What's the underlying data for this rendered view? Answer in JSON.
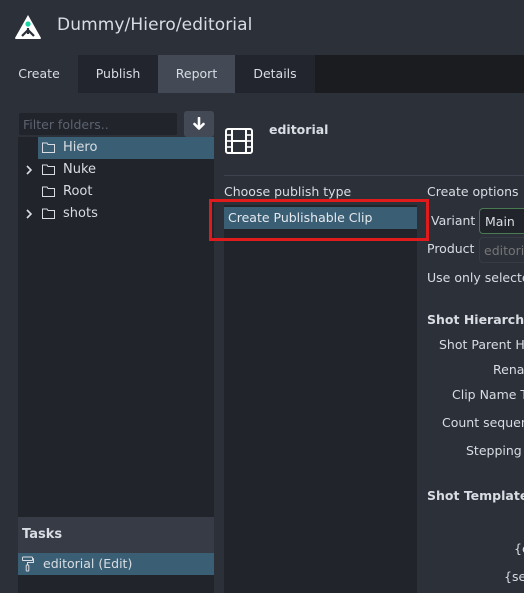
{
  "window": {
    "title": "Dummy/Hiero/editorial",
    "logo_icon": "ayon-logo-icon"
  },
  "tabs": [
    {
      "label": "Create",
      "active": false
    },
    {
      "label": "Publish",
      "active": false
    },
    {
      "label": "Report",
      "active": true
    },
    {
      "label": "Details",
      "active": false
    }
  ],
  "folders": {
    "filter_placeholder": "Filter folders..",
    "filter_value": "",
    "action_icon": "arrow-down-icon",
    "items": [
      {
        "label": "Hiero",
        "expandable": false,
        "selected": true
      },
      {
        "label": "Nuke",
        "expandable": true,
        "selected": false
      },
      {
        "label": "Root",
        "expandable": false,
        "selected": false
      },
      {
        "label": "shots",
        "expandable": true,
        "selected": false
      }
    ]
  },
  "tasks": {
    "header": "Tasks",
    "items": [
      {
        "label": "editorial (Edit)",
        "icon": "paint-roller-icon",
        "selected": true
      }
    ]
  },
  "context": {
    "icon": "film-icon",
    "title": "editorial"
  },
  "publish_types": {
    "label": "Choose publish type",
    "items": [
      {
        "label": "Create Publishable Clip",
        "selected": true
      }
    ]
  },
  "create_options": {
    "header": "Create options",
    "variant_label": "Variant",
    "variant_value": "Main",
    "product_label": "Product",
    "product_placeholder": "editorial",
    "use_only_selected": "Use only selected",
    "shot_hierarchy_header": "Shot Hierarchy",
    "shot_hierarchy_fields": [
      "Shot Parent Hierarchy",
      "Rename",
      "Clip Name Template",
      "Count sequence",
      "Stepping"
    ],
    "shot_template_header": "Shot Template",
    "shot_template_fields": [
      "{episode}",
      "{sequence}"
    ]
  },
  "colors": {
    "accent_selected": "#3a5f75",
    "highlight_annotation": "#e01b1b",
    "variant_border": "#4a7a52"
  }
}
